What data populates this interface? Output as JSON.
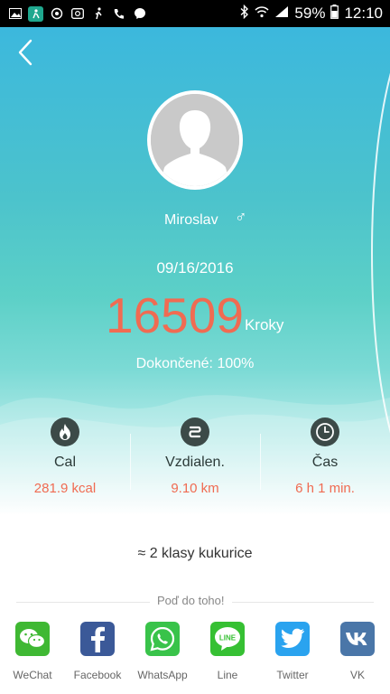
{
  "status_bar": {
    "battery": "59%",
    "time": "12:10"
  },
  "profile": {
    "name": "Miroslav",
    "gender_symbol": "♂"
  },
  "summary": {
    "date": "09/16/2016",
    "steps": "16509",
    "steps_unit": "Kroky",
    "completed": "Dokončené: 100%"
  },
  "stats": [
    {
      "label": "Cal",
      "value": "281.9 kcal",
      "icon": "flame-icon"
    },
    {
      "label": "Vzdialen.",
      "value": "9.10  km",
      "icon": "distance-icon"
    },
    {
      "label": "Čas",
      "value": "6 h 1 min.",
      "icon": "clock-icon"
    }
  ],
  "equivalent": "≈ 2 klasy kukurice",
  "share": {
    "title": "Poď do toho!",
    "items": [
      {
        "label": "WeChat",
        "color": "#3fb833"
      },
      {
        "label": "Facebook",
        "color": "#3b5998"
      },
      {
        "label": "WhatsApp",
        "color": "#39c34a"
      },
      {
        "label": "Line",
        "color": "#36c033"
      },
      {
        "label": "Twitter",
        "color": "#2aa3ef"
      },
      {
        "label": "VK",
        "color": "#4a76a8"
      }
    ]
  },
  "colors": {
    "accent": "#f06b52",
    "hero_top": "#3cb8dd",
    "hero_mid": "#5cd0c7"
  }
}
